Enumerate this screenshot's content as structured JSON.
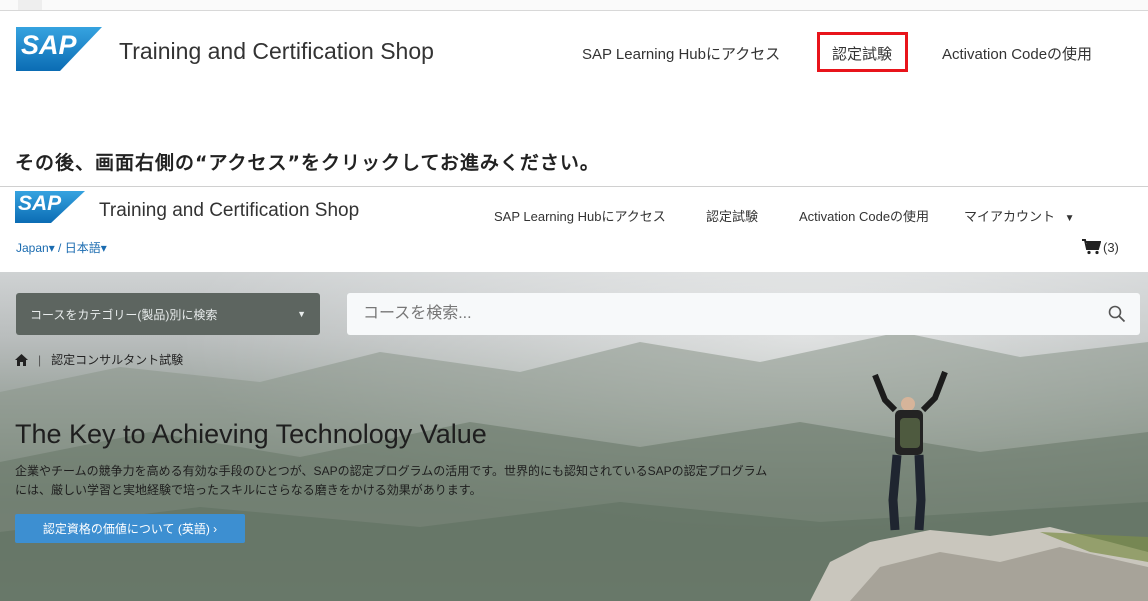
{
  "header1": {
    "logo_text": "SAP",
    "title": "Training and Certification Shop",
    "nav": [
      "SAP Learning Hubにアクセス",
      "認定試験",
      "Activation Codeの使用"
    ]
  },
  "caption": "その後、画面右側の“アクセス”をクリックしてお進みください。",
  "header2": {
    "logo_text": "SAP",
    "title": "Training and Certification Shop",
    "nav": [
      "SAP Learning Hubにアクセス",
      "認定試験",
      "Activation Codeの使用",
      "マイアカウント"
    ],
    "locale": "Japan▾ / 日本語▾",
    "cart_count": "(3)"
  },
  "hero": {
    "category_button": "コースをカテゴリー(製品)別に検索",
    "search_placeholder": "コースを検索...",
    "breadcrumb_separator": "|",
    "breadcrumb": "認定コンサルタント試験",
    "title": "The Key to Achieving Technology Value",
    "description": "企業やチームの競争力を高める有効な手段のひとつが、SAPの認定プログラムの活用です。世界的にも認知されているSAPの認定プログラムには、厳しい学習と実地経験で培ったスキルにさらなる磨きをかける効果があります。",
    "cta": "認定資格の価値について (英語) ›"
  },
  "colors": {
    "highlight": "#e8141b",
    "sap_blue": "#1a7dc4",
    "cta_blue": "#3d8fd1"
  }
}
